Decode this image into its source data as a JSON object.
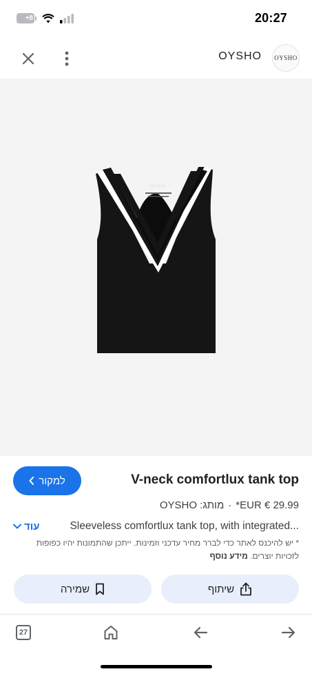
{
  "status": {
    "time": "20:27",
    "battery": "+8"
  },
  "header": {
    "site_name": "OYSHO",
    "logo_text": "OYSHO",
    "close_icon": "close-icon",
    "more_icon": "more-vert-icon"
  },
  "product": {
    "title": "V-neck comfortlux tank top",
    "price": "*EUR € 29.99",
    "separator": "·",
    "brand": "מותג: OYSHO",
    "description": "Sleeveless comfortlux tank top, with integrated...",
    "more_label": "עוד",
    "disclaimer": "* יש להיכנס לאתר כדי לברר מחיר עדכני וזמינות. ייתכן שהתמונות יהיו כפופות לזכויות יוצרים.",
    "disclaimer_link": "מידע נוסף",
    "garment_label": "OYSHO"
  },
  "actions": {
    "source_label": "למקור",
    "save_label": "שמירה",
    "share_label": "שיתוף"
  },
  "bottom_nav": {
    "tabs_count": "27"
  },
  "colors": {
    "accent": "#1a73e8",
    "action_bg": "#e8eefb",
    "image_bg": "#f4f4f4"
  }
}
